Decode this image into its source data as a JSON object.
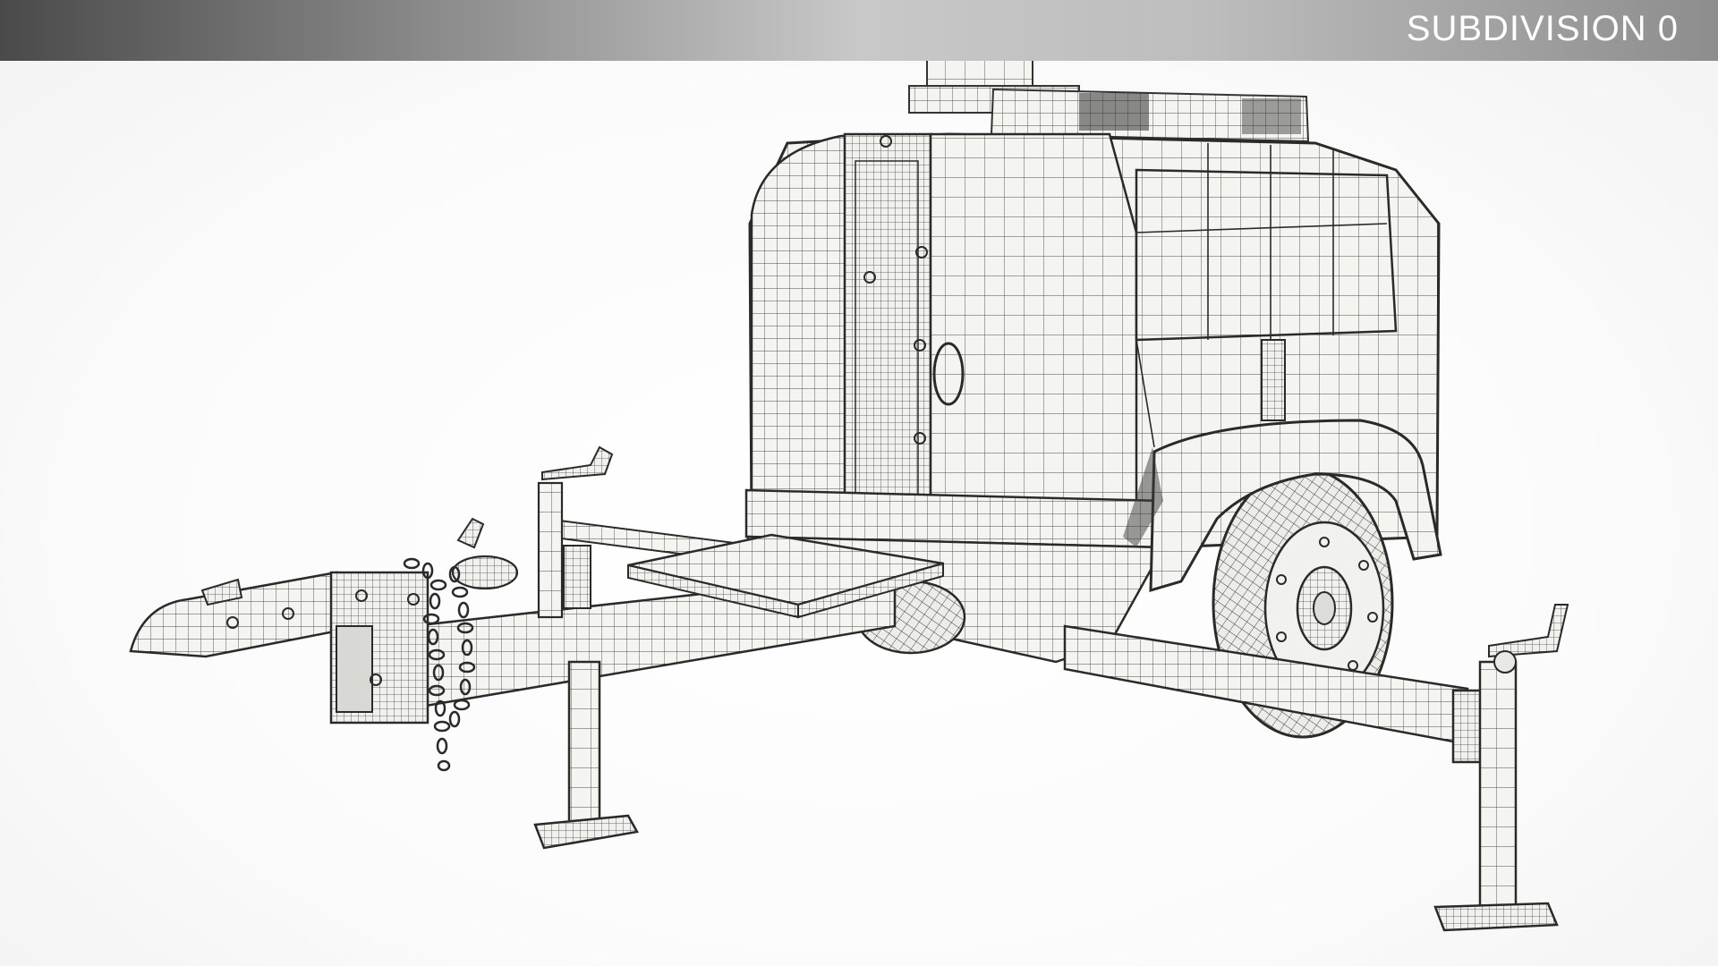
{
  "banner": {
    "label": "SUBDIVISION 0"
  },
  "scene": {
    "subject": "wireframe-trailer-generator-model",
    "background_color": "#ffffff",
    "mesh_fill": "#f4f4f1",
    "mesh_line": "#3a3a3a"
  }
}
